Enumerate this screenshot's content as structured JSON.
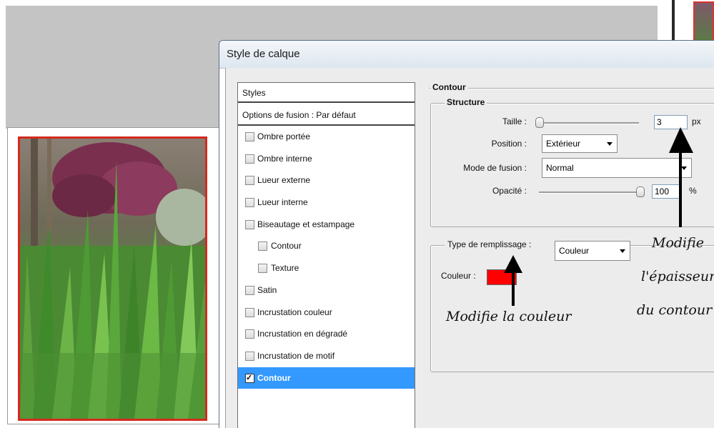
{
  "dialog": {
    "title": "Style de calque"
  },
  "styles_panel": {
    "header": "Styles",
    "blend_options": "Options de fusion : Par défaut",
    "items": [
      {
        "label": "Ombre portée",
        "checked": false,
        "sub": false
      },
      {
        "label": "Ombre interne",
        "checked": false,
        "sub": false
      },
      {
        "label": "Lueur externe",
        "checked": false,
        "sub": false
      },
      {
        "label": "Lueur interne",
        "checked": false,
        "sub": false
      },
      {
        "label": "Biseautage et estampage",
        "checked": false,
        "sub": false
      },
      {
        "label": "Contour",
        "checked": false,
        "sub": true
      },
      {
        "label": "Texture",
        "checked": false,
        "sub": true
      },
      {
        "label": "Satin",
        "checked": false,
        "sub": false
      },
      {
        "label": "Incrustation couleur",
        "checked": false,
        "sub": false
      },
      {
        "label": "Incrustation en dégradé",
        "checked": false,
        "sub": false
      },
      {
        "label": "Incrustation de motif",
        "checked": false,
        "sub": false
      },
      {
        "label": "Contour",
        "checked": true,
        "sub": false,
        "active": true
      }
    ]
  },
  "contour": {
    "section_title": "Contour",
    "structure_title": "Structure",
    "size_label": "Taille :",
    "size_value": "3",
    "size_unit": "px",
    "position_label": "Position :",
    "position_value": "Extérieur",
    "blend_label": "Mode de fusion :",
    "blend_value": "Normal",
    "opacity_label": "Opacité :",
    "opacity_value": "100",
    "opacity_unit": "%",
    "fill_type_label": "Type de remplissage :",
    "fill_type_value": "Couleur",
    "color_label": "Couleur :",
    "color_value": "#ff0000"
  },
  "annotations": {
    "left": "Modifie la couleur",
    "right_line1": "Modifie",
    "right_line2": "l'épaisseur",
    "right_line3": "du contour"
  },
  "colors": {
    "selection": "#3399ff",
    "photo_border": "#d42a1f",
    "stroke_color": "#ff0000"
  }
}
